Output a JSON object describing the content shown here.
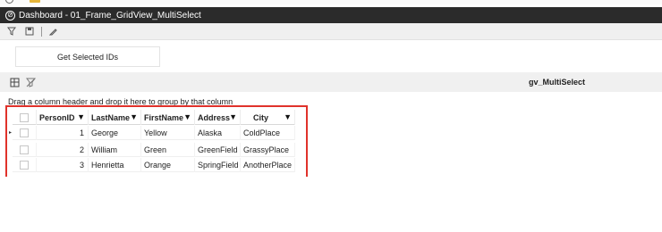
{
  "window": {
    "title": "Dashboard - 01_Frame_GridView_MultiSelect"
  },
  "toolbar": {
    "icons": [
      "filter-icon",
      "save-icon",
      "edit-icon"
    ]
  },
  "actions": {
    "get_selected_label": "Get Selected IDs"
  },
  "grid": {
    "name": "gv_MultiSelect",
    "group_panel_text": "Drag a column header and drop it here to group by that column",
    "columns": [
      "PersonID",
      "LastName",
      "FirstName",
      "Address",
      "City"
    ],
    "rows": [
      {
        "id": "1",
        "last": "George",
        "first": "Yellow",
        "address": "Alaska",
        "city": "ColdPlace"
      },
      {
        "id": "2",
        "last": "William",
        "first": "Green",
        "address": "GreenField",
        "city": "GrassyPlace"
      },
      {
        "id": "3",
        "last": "Henrietta",
        "first": "Orange",
        "address": "SpringField",
        "city": "AnotherPlace"
      }
    ],
    "active_row_indicator": "▸"
  },
  "colors": {
    "titlebar": "#2b2b2b",
    "toolbar": "#f0f0f0",
    "highlight": "#e0322b"
  }
}
